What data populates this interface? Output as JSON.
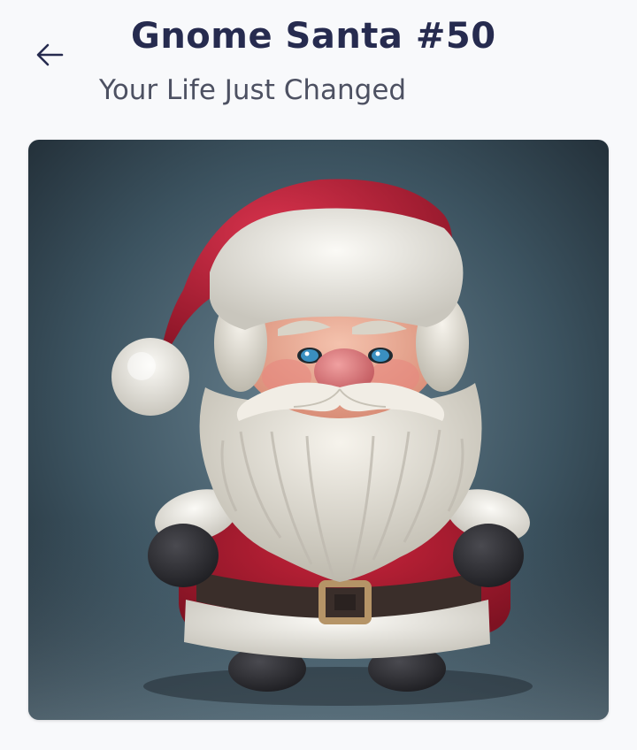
{
  "header": {
    "back_icon": "arrow-left-icon",
    "title": "Gnome Santa #50",
    "subtitle": "Your Life Just Changed"
  },
  "artwork": {
    "subject": "gnome-santa",
    "colors": {
      "background_top": "#22303a",
      "background_bottom": "#5c7684",
      "hat_red": "#b51f37",
      "fur_white": "#ece9e1",
      "beard": "#e6e2d8",
      "skin": "#e9a892",
      "nose": "#d9787a",
      "eyes": "#3a8fc0",
      "belt": "#3a2e2a",
      "buckle": "#b59467",
      "mittens": "#2f2f33",
      "boots": "#26262a"
    }
  },
  "theme": {
    "title_color": "#262b4f",
    "subtitle_color": "#4d5162",
    "page_bg": "#f8f9fb"
  }
}
